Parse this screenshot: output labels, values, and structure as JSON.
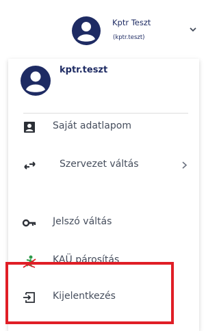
{
  "header": {
    "display_name": "Kptr Teszt",
    "username": "(kptr.teszt)",
    "avatar_icon": "account-circle-icon",
    "chevron_icon": "chevron-down-icon"
  },
  "panel": {
    "username": "kptr.teszt",
    "avatar_icon": "account-circle-icon"
  },
  "menu": {
    "items": [
      {
        "label": "Saját adatlapom",
        "icon": "contact-card-icon"
      },
      {
        "label": "Szervezet váltás",
        "icon": "switch-arrows-icon",
        "arrow": "chevron-right-icon"
      },
      {
        "label": "Jelszó váltás",
        "icon": "key-icon"
      },
      {
        "label": "KAÜ párosítás",
        "icon": "pairing-icon"
      },
      {
        "label": "Kijelentkezés",
        "icon": "logout-icon"
      }
    ]
  },
  "colors": {
    "brand_navy": "#1e2b63",
    "text_gray": "#454d5c",
    "highlight_red": "#e01e26"
  }
}
